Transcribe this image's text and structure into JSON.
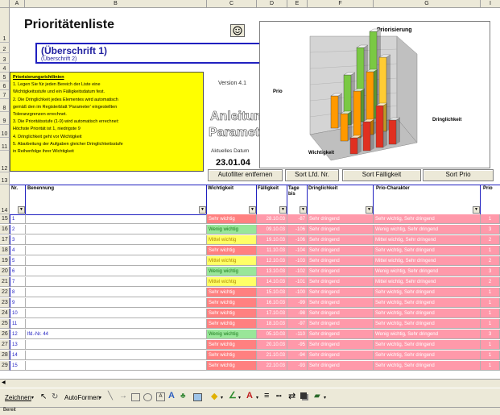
{
  "column_headers": [
    "A",
    "B",
    "C",
    "D",
    "E",
    "F",
    "G",
    "I"
  ],
  "row_numbers": [
    "1",
    "2",
    "3",
    "4",
    "5",
    "6",
    "7",
    "8",
    "9",
    "10",
    "11",
    "12",
    "13",
    "14"
  ],
  "title": "Prioritätenliste",
  "heading1": "(Überschrift 1)",
  "heading2": "(Überschrift 2)",
  "instructions_title": "Priorisierungsrichtlinien",
  "instructions_lines": [
    "1. Legen Sie für jeden Bereich der Liste eine",
    "Wichtigkeitsstufe und ein Fälligkeitsdatum fest.",
    "2. Die Dringlichkeit jedes Elementes wird automatisch",
    "gemäß den im Registerblatt 'Parameter' eingestellten",
    "Toleranzgrenzen errechnet.",
    "3. Die Prioritätsstufe (1-9) wird automatisch errechnet:",
    "Höchste Priorität ist 1, niedrigste 9",
    "4. Dringlichkeit geht vor Wichtigkeit",
    "5. Abarbeitung der Aufgaben gleicher Dringlichkeitsstufe",
    "in Reihenfolge ihrer Wichtigkeit"
  ],
  "version": "Version 4.1",
  "anleitung": "Anleitung",
  "parameter": "Parameter",
  "aktuelles_datum_label": "Aktuelles Datum",
  "date": "23.01.04",
  "chart": {
    "title": "Priorisierung",
    "axis_left": "Prio",
    "axis_bottom": "Wichtigkeit",
    "axis_right": "Dringlichkeit"
  },
  "buttons": {
    "autofilter": "Autofilter entfernen",
    "sort_lfd": "Sort Lfd. Nr.",
    "sort_faelligkeit": "Sort Fälligkeit",
    "sort_prio": "Sort Prio"
  },
  "table_headers": [
    "Nr.",
    "Benennung",
    "Wichtigkeit",
    "Fälligkeit",
    "Tage bis",
    "Dringlichkeit",
    "Prio-Charakter",
    "Prio"
  ],
  "rows": [
    {
      "row": "15",
      "nr": "1",
      "ben": "",
      "wicht": "Sehr wichtig",
      "faell": "28.10.03",
      "tage": "-87",
      "dring": "Sehr dringend",
      "prio_char": "Sehr wichtig, Sehr dringend",
      "prio": "1"
    },
    {
      "row": "16",
      "nr": "2",
      "ben": "",
      "wicht": "Wenig wichtig",
      "faell": "09.10.03",
      "tage": "-106",
      "dring": "Sehr dringend",
      "prio_char": "Wenig wichtig, Sehr dringend",
      "prio": "3"
    },
    {
      "row": "17",
      "nr": "3",
      "ben": "",
      "wicht": "Mittel wichtig",
      "faell": "19.10.03",
      "tage": "-106",
      "dring": "Sehr dringend",
      "prio_char": "Mittel wichtig, Sehr dringend",
      "prio": "2"
    },
    {
      "row": "18",
      "nr": "4",
      "ben": "",
      "wicht": "Sehr wichtig",
      "faell": "11.10.03",
      "tage": "-104",
      "dring": "Sehr dringend",
      "prio_char": "Sehr wichtig, Sehr dringend",
      "prio": "1"
    },
    {
      "row": "19",
      "nr": "5",
      "ben": "",
      "wicht": "Mittel wichtig",
      "faell": "12.10.03",
      "tage": "-103",
      "dring": "Sehr dringend",
      "prio_char": "Mittel wichtig, Sehr dringend",
      "prio": "2"
    },
    {
      "row": "20",
      "nr": "6",
      "ben": "",
      "wicht": "Wenig wichtig",
      "faell": "13.10.03",
      "tage": "-102",
      "dring": "Sehr dringend",
      "prio_char": "Wenig wichtig, Sehr dringend",
      "prio": "3"
    },
    {
      "row": "21",
      "nr": "7",
      "ben": "",
      "wicht": "Mittel wichtig",
      "faell": "14.10.03",
      "tage": "-101",
      "dring": "Sehr dringend",
      "prio_char": "Mittel wichtig, Sehr dringend",
      "prio": "2"
    },
    {
      "row": "22",
      "nr": "8",
      "ben": "",
      "wicht": "Sehr wichtig",
      "faell": "15.10.03",
      "tage": "-100",
      "dring": "Sehr dringend",
      "prio_char": "Sehr wichtig, Sehr dringend",
      "prio": "1"
    },
    {
      "row": "23",
      "nr": "9",
      "ben": "",
      "wicht": "Sehr wichtig",
      "faell": "16.10.03",
      "tage": "-99",
      "dring": "Sehr dringend",
      "prio_char": "Sehr wichtig, Sehr dringend",
      "prio": "1"
    },
    {
      "row": "24",
      "nr": "10",
      "ben": "",
      "wicht": "Sehr wichtig",
      "faell": "17.10.03",
      "tage": "-98",
      "dring": "Sehr dringend",
      "prio_char": "Sehr wichtig, Sehr dringend",
      "prio": "1"
    },
    {
      "row": "25",
      "nr": "11",
      "ben": "",
      "wicht": "Sehr wichtig",
      "faell": "18.10.03",
      "tage": "-97",
      "dring": "Sehr dringend",
      "prio_char": "Sehr wichtig, Sehr dringend",
      "prio": "1"
    },
    {
      "row": "26",
      "nr": "12",
      "ben": "lfd.-Nr. 44",
      "wicht": "Wenig wichtig",
      "faell": "05.10.03",
      "tage": "-110",
      "dring": "Sehr dringend",
      "prio_char": "Wenig wichtig, Sehr dringend",
      "prio": "3"
    },
    {
      "row": "27",
      "nr": "13",
      "ben": "",
      "wicht": "Sehr wichtig",
      "faell": "20.10.03",
      "tage": "-95",
      "dring": "Sehr dringend",
      "prio_char": "Sehr wichtig, Sehr dringend",
      "prio": "1"
    },
    {
      "row": "28",
      "nr": "14",
      "ben": "",
      "wicht": "Sehr wichtig",
      "faell": "21.10.03",
      "tage": "-94",
      "dring": "Sehr dringend",
      "prio_char": "Sehr wichtig, Sehr dringend",
      "prio": "1"
    },
    {
      "row": "29",
      "nr": "15",
      "ben": "",
      "wicht": "Sehr wichtig",
      "faell": "22.10.03",
      "tage": "-93",
      "dring": "Sehr dringend",
      "prio_char": "Sehr wichtig, Sehr dringend",
      "prio": "1"
    }
  ],
  "wicht_colors": {
    "Sehr wichtig": "#ff8080",
    "Wenig wichtig": "#99e699",
    "Mittel wichtig": "#ffff66"
  },
  "row_fill": "#ff99aa",
  "toolbar": {
    "zeichnen": "Zeichnen",
    "autoformen": "AutoFormen"
  },
  "status": "Bereit"
}
